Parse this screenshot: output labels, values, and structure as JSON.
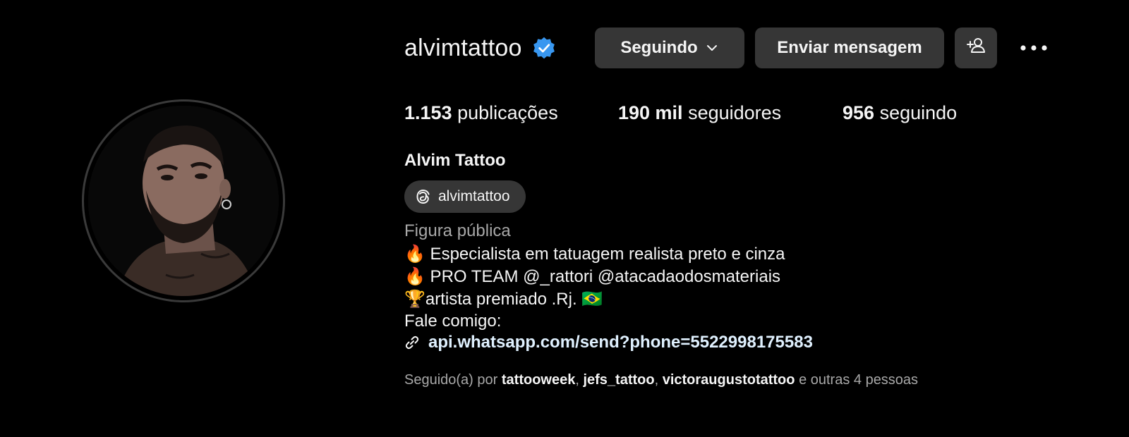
{
  "profile": {
    "username": "alvimtattoo",
    "verified_color": "#3897f0",
    "full_name": "Alvim Tattoo",
    "threads_handle": "alvimtattoo",
    "category": "Figura pública",
    "bio": [
      {
        "emoji": "🔥",
        "text": " Especialista em tatuagem realista preto e cinza"
      },
      {
        "emoji": "🔥",
        "text": " PRO TEAM @_rattori @atacadaodosmateriais"
      },
      {
        "emoji": "🏆",
        "text": "artista premiado .Rj. ",
        "emoji_after": "🇧🇷"
      },
      {
        "emoji": "",
        "text": "Fale comigo:"
      }
    ],
    "link": "api.whatsapp.com/send?phone=5522998175583"
  },
  "actions": {
    "following_label": "Seguindo",
    "message_label": "Enviar mensagem"
  },
  "stats": {
    "posts_value": "1.153",
    "posts_label": "publicações",
    "followers_value": "190 mil",
    "followers_label": "seguidores",
    "following_value": "956",
    "following_label": "seguindo"
  },
  "followed_by": {
    "prefix": "Seguido(a) por",
    "users": [
      "tattooweek",
      "jefs_tattoo",
      "victoraugustotattoo"
    ],
    "suffix": "e outras 4 pessoas"
  },
  "icons": {
    "verified": "verified-badge-icon",
    "chevron": "chevron-down-icon",
    "add_user": "add-user-icon",
    "more": "more-options-icon",
    "threads": "threads-icon",
    "link": "link-icon"
  }
}
